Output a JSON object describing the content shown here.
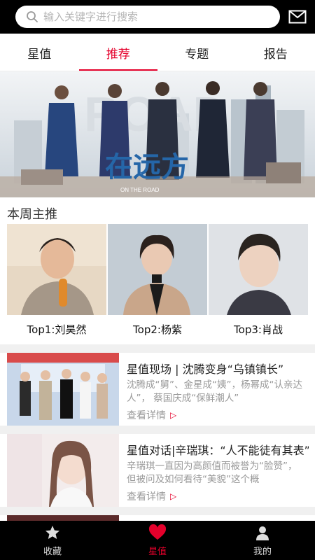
{
  "search": {
    "placeholder": "输入关键字进行搜索"
  },
  "tabs": [
    {
      "label": "星值"
    },
    {
      "label": "推荐"
    },
    {
      "label": "专题"
    },
    {
      "label": "报告"
    }
  ],
  "banner": {
    "title_art": "在远方",
    "subtitle": "ON THE ROAD"
  },
  "weekly": {
    "title": "本周主推",
    "items": [
      {
        "label": "Top1:刘昊然"
      },
      {
        "label": "Top2:杨紫"
      },
      {
        "label": "Top3:肖战"
      }
    ]
  },
  "articles": [
    {
      "title": "星值现场 | 沈腾变身“乌镇镇长”",
      "desc": "沈腾成“舅”、金星成“姨”，杨幂成“认亲达人”， 蔡国庆成“保鲜潮人”",
      "more": "查看详情"
    },
    {
      "title": "星值对话|辛瑞琪：“人不能徒有其表”",
      "desc": "辛瑞琪一直因为高颜值而被誉为“脸赞”，但被问及如何看待“美貌”这个概",
      "more": "查看详情"
    }
  ],
  "bottom_nav": [
    {
      "label": "收藏",
      "icon": "star-icon"
    },
    {
      "label": "星值",
      "icon": "heart-icon"
    },
    {
      "label": "我的",
      "icon": "user-icon"
    }
  ],
  "colors": {
    "accent": "#e4002b",
    "bar": "#000000"
  }
}
